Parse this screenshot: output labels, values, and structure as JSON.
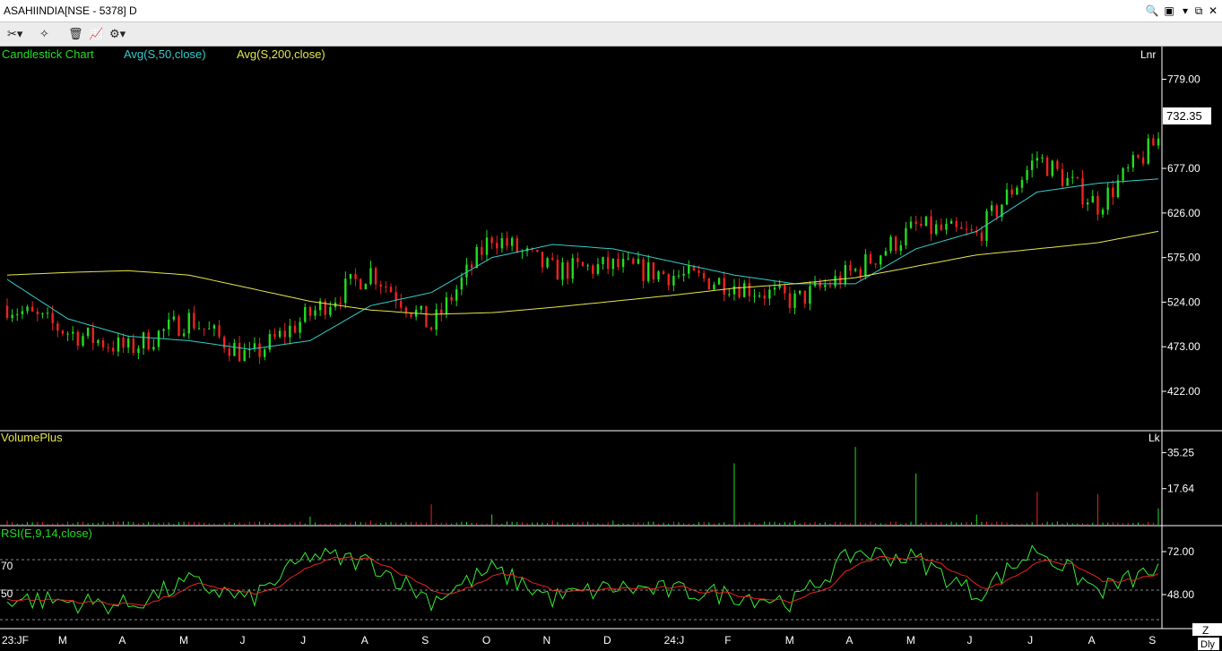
{
  "window": {
    "title": "ASAHIINDIA[NSE - 5378] D",
    "buttons": [
      "search-icon",
      "restore-icon",
      "dropdown-icon",
      "tile-icon",
      "close-icon"
    ]
  },
  "toolbar": {
    "tools": [
      "drawing-tools-icon",
      "crosshair-tools-icon",
      "delete-objects-icon",
      "indicators-icon",
      "settings-icon"
    ]
  },
  "panels": {
    "price": {
      "legend": {
        "chart": "Candlestick Chart",
        "ma50": "Avg(S,50,close)",
        "ma200": "Avg(S,200,close)"
      },
      "scale_tag": "Lnr",
      "last_price": "732.35",
      "ticks": [
        "779.00",
        "677.00",
        "626.00",
        "575.00",
        "524.00",
        "473.00",
        "422.00"
      ]
    },
    "volume": {
      "legend": "VolumePlus",
      "scale_tag": "Lk",
      "ticks": [
        "35.25",
        "17.64"
      ]
    },
    "rsi": {
      "legend": "RSI(E,9,14,close)",
      "left_levels": [
        "70",
        "50"
      ],
      "ticks": [
        "72.00",
        "48.00"
      ]
    }
  },
  "x_axis": {
    "labels": [
      "23:JF",
      "M",
      "A",
      "M",
      "J",
      "J",
      "A",
      "S",
      "O",
      "N",
      "D",
      "24:J",
      "F",
      "M",
      "A",
      "M",
      "J",
      "J",
      "A",
      "S"
    ],
    "zoom_label": "Z",
    "period_label": "Dly"
  },
  "colors": {
    "background": "#000000",
    "up": "#22dd22",
    "down": "#ee2222",
    "ma50": "#33cccc",
    "ma200": "#e6e64c",
    "rsi": "#33ee33",
    "rsi_signal": "#ee2222",
    "legend_green": "#22dd22",
    "legend_cyan": "#33cccc",
    "legend_yellow": "#e6e64c",
    "text_white": "#ffffff"
  },
  "chart_data": [
    {
      "type": "line",
      "title": "Candlestick Chart",
      "x": [
        "23:JF",
        "M",
        "A",
        "M",
        "J",
        "J",
        "A",
        "S",
        "O",
        "N",
        "D",
        "24:J",
        "F",
        "M",
        "A",
        "M",
        "J",
        "J",
        "A",
        "S"
      ],
      "series": [
        {
          "name": "Candlestick Chart",
          "values": [
            520,
            490,
            470,
            505,
            460,
            510,
            560,
            495,
            600,
            560,
            565,
            555,
            545,
            525,
            560,
            610,
            600,
            690,
            635,
            710
          ]
        },
        {
          "name": "Avg(S,50,close)",
          "values": [
            550,
            505,
            485,
            480,
            470,
            480,
            520,
            535,
            575,
            590,
            585,
            570,
            555,
            545,
            545,
            585,
            605,
            650,
            660,
            665
          ]
        },
        {
          "name": "Avg(S,200,close)",
          "values": [
            555,
            558,
            560,
            555,
            540,
            525,
            515,
            510,
            512,
            518,
            525,
            532,
            540,
            545,
            552,
            565,
            578,
            585,
            592,
            605
          ]
        }
      ],
      "ylim": [
        380,
        800
      ],
      "last_value": 732.35
    },
    {
      "type": "bar",
      "title": "VolumePlus",
      "x": [
        "23:JF",
        "M",
        "A",
        "M",
        "J",
        "J",
        "A",
        "S",
        "O",
        "N",
        "D",
        "24:J",
        "F",
        "M",
        "A",
        "M",
        "J",
        "J",
        "A",
        "S"
      ],
      "values": [
        2,
        1.5,
        1.5,
        1.5,
        1.5,
        4,
        2,
        10,
        5,
        2,
        2,
        1.5,
        30,
        2,
        38,
        25,
        5,
        16,
        15,
        8
      ],
      "ylim": [
        0,
        42
      ]
    },
    {
      "type": "line",
      "title": "RSI(E,9,14,close)",
      "x": [
        "23:JF",
        "M",
        "A",
        "M",
        "J",
        "J",
        "A",
        "S",
        "O",
        "N",
        "D",
        "24:J",
        "F",
        "M",
        "A",
        "M",
        "J",
        "J",
        "A",
        "S"
      ],
      "series": [
        {
          "name": "RSI(E,9,14,close)",
          "values": [
            46,
            44,
            42,
            55,
            45,
            70,
            66,
            45,
            62,
            46,
            52,
            50,
            48,
            44,
            72,
            68,
            48,
            74,
            50,
            62
          ]
        }
      ],
      "ylim": [
        30,
        80
      ]
    }
  ]
}
